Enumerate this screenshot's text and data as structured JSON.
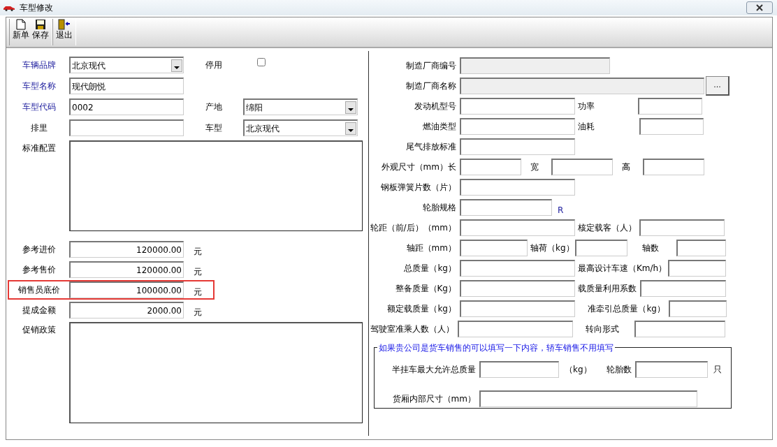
{
  "window": {
    "title": "车型修改"
  },
  "toolbar": [
    {
      "label": "新单",
      "kind": "new"
    },
    {
      "label": "保存",
      "kind": "save"
    },
    {
      "label": "退出",
      "kind": "exit"
    }
  ],
  "left": {
    "brand": {
      "label": "车辆品牌",
      "value": "北京现代",
      "required": true
    },
    "inactive": {
      "label": "停用",
      "checked": false
    },
    "name": {
      "label": "车型名称",
      "value": "现代朗悦",
      "required": true
    },
    "code": {
      "label": "车型代码",
      "value": "0002",
      "required": true
    },
    "origin": {
      "label": "产地",
      "value": "绵阳",
      "required": false
    },
    "displacement": {
      "label": "排里",
      "required": false
    },
    "vehicle_type": {
      "label": "车型",
      "value": "北京现代",
      "required": false
    },
    "standard_config": {
      "label": "标准配置"
    },
    "prices": [
      {
        "label": "参考进价",
        "value": "120000.00",
        "unit": "元",
        "highlighted": false
      },
      {
        "label": "参考售价",
        "value": "120000.00",
        "unit": "元",
        "highlighted": false
      },
      {
        "label": "销售员底价",
        "value": "100000.00",
        "unit": "元",
        "highlighted": true
      },
      {
        "label": "提成金额",
        "value": "2000.00",
        "unit": "元",
        "highlighted": false
      }
    ],
    "promotion": {
      "label": "促销政策"
    }
  },
  "right_rows": [
    {
      "fields": [
        {
          "label": "制造厂商编号",
          "disabled": true
        }
      ]
    },
    {
      "fields": [
        {
          "label": "制造厂商名称",
          "disabled": true
        }
      ],
      "button": "..."
    },
    {
      "fields": [
        {
          "label": "发动机型号",
          "disabled": false
        },
        {
          "label": "功率",
          "disabled": false
        }
      ]
    },
    {
      "fields": [
        {
          "label": "燃油类型",
          "disabled": false
        },
        {
          "label": "油耗",
          "disabled": false
        }
      ]
    },
    {
      "fields": [
        {
          "label": "尾气排放标准",
          "disabled": false
        }
      ]
    },
    {
      "fields": [
        {
          "label": "外观尺寸（mm）长",
          "disabled": false
        },
        {
          "label": "宽",
          "disabled": false
        },
        {
          "label": "高",
          "disabled": false
        }
      ]
    },
    {
      "fields": [
        {
          "label": "钢板弹簧片数（片）",
          "disabled": false
        }
      ]
    },
    {
      "fields": [
        {
          "label": "轮胎规格",
          "disabled": false
        }
      ],
      "suffix": "R"
    },
    {
      "fields": [
        {
          "label": "轮距（前/后）（mm）",
          "disabled": false
        },
        {
          "label": "核定载客（人）",
          "disabled": false
        }
      ]
    },
    {
      "fields": [
        {
          "label": "轴距（mm）",
          "disabled": false
        },
        {
          "label": "轴荷（kg）",
          "disabled": false
        },
        {
          "label": "轴数",
          "disabled": false
        }
      ]
    },
    {
      "fields": [
        {
          "label": "总质量（kg）",
          "disabled": false
        },
        {
          "label": "最高设计车速（Km/h）",
          "disabled": false
        }
      ]
    },
    {
      "fields": [
        {
          "label": "整备质量（Kg）",
          "disabled": false
        },
        {
          "label": "载质量利用系数",
          "disabled": false
        }
      ]
    },
    {
      "fields": [
        {
          "label": "额定载质量（kg）",
          "disabled": false
        },
        {
          "label": "准牵引总质量（kg）",
          "disabled": false
        }
      ]
    },
    {
      "fields": [
        {
          "label": "驾驶室准乘人数（人）",
          "disabled": false
        },
        {
          "label": "转向形式",
          "disabled": false
        }
      ]
    }
  ],
  "truck_group": {
    "legend": "如果贵公司是货车销售的可以填写一下内容，轿车销售不用填写",
    "rows": [
      {
        "fields": [
          {
            "label": "半挂车最大允许总质量",
            "unit": "（kg）"
          },
          {
            "label": "轮胎数",
            "unit": "只"
          }
        ]
      },
      {
        "fields": [
          {
            "label": "货厢内部尺寸（mm）"
          }
        ]
      }
    ]
  }
}
